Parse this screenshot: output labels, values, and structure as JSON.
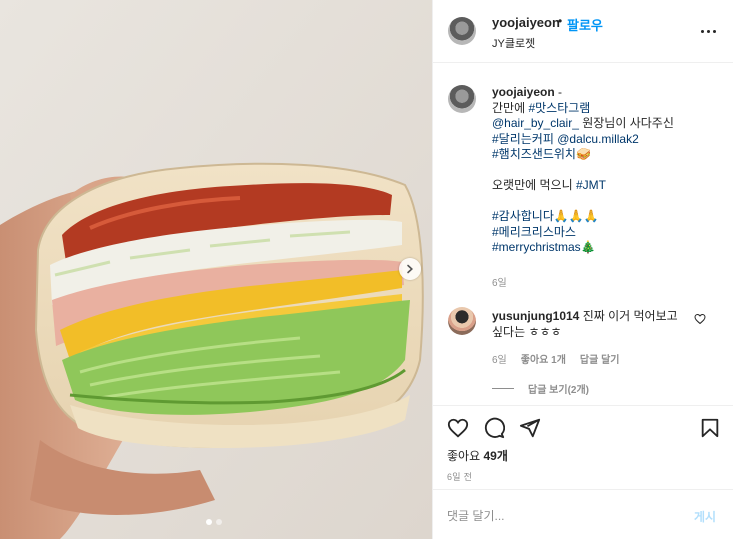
{
  "post": {
    "username": "yoojaiyeon",
    "separator": "•",
    "follow_label": "팔로우",
    "subtitle": "JY클로젯",
    "more_icon": "more-horizontal-icon"
  },
  "photo": {
    "carousel_total": 2,
    "carousel_active": 1,
    "next_icon": "chevron-right-icon"
  },
  "caption": {
    "username": "yoojaiyeon",
    "dash": "-",
    "line1_prefix": "간만에 ",
    "line1_tag": "#맛스타그램",
    "line2_mention": "@hair_by_clair_",
    "line2_text": " 원장님이 사다주신",
    "line3_tag": "#달리는커피",
    "line3_mention": "@dalcu.millak2",
    "line4_tag": "#햄치즈샌드위치",
    "line4_emoji": "🥪",
    "line5_text": "오랫만에 먹으니 ",
    "line5_tag": "#JMT",
    "line6_tag": "#감사합니다",
    "line6_emoji": "🙏🙏🙏",
    "line7_tag": "#메리크리스마스",
    "line8_tag": "#merrychristmas",
    "line8_emoji": "🎄",
    "time": "6일"
  },
  "comment": {
    "username": "yusunjung1014",
    "text": " 진짜 이거 먹어보고 싶다는 ㅎㅎㅎ",
    "time": "6일",
    "likes": "좋아요 1개",
    "reply_label": "답글 달기",
    "view_replies": "답글 보기(2개)"
  },
  "actions": {
    "likes_prefix": "좋아요 ",
    "likes_count": "49개",
    "post_time": "6일 전"
  },
  "comment_input": {
    "placeholder": "댓글 달기...",
    "post_label": "게시"
  },
  "colors": {
    "accent": "#0095f6",
    "link": "#00376b",
    "muted": "#8e8e8e",
    "post_disabled": "#b2dffc"
  }
}
